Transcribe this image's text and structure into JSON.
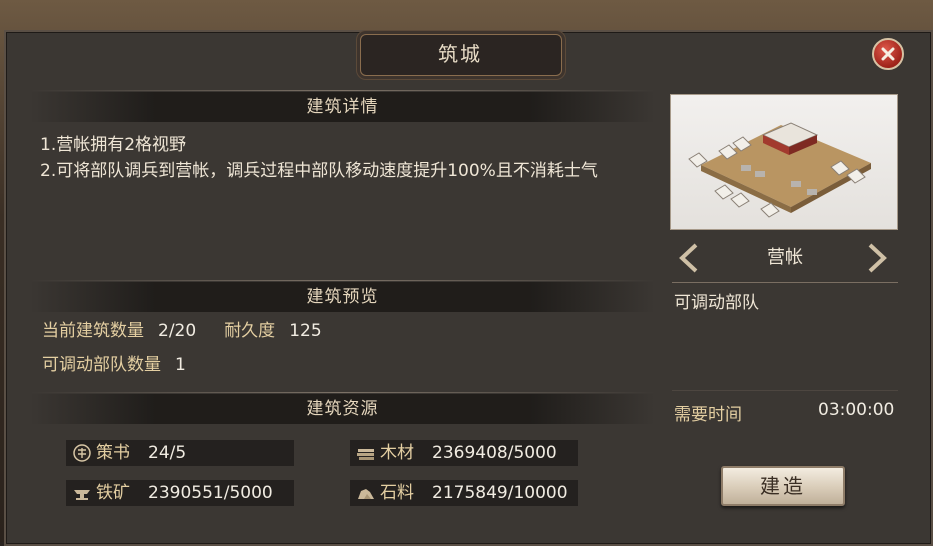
{
  "dialog": {
    "title": "筑城"
  },
  "details": {
    "header": "建筑详情",
    "lines": [
      "1.营帐拥有2格视野",
      "2.可将部队调兵到营帐，调兵过程中部队移动速度提升100%且不消耗士气"
    ]
  },
  "preview": {
    "header": "建筑预览",
    "count_label": "当前建筑数量",
    "count_value": "2/20",
    "durability_label": "耐久度",
    "durability_value": "125",
    "troops_label": "可调动部队数量",
    "troops_value": "1"
  },
  "resources": {
    "header": "建筑资源",
    "items": [
      {
        "icon": "strategy-book-icon",
        "label": "策书",
        "value": "24/5"
      },
      {
        "icon": "wood-icon",
        "label": "木材",
        "value": "2369408/5000"
      },
      {
        "icon": "iron-ore-icon",
        "label": "铁矿",
        "value": "2390551/5000"
      },
      {
        "icon": "stone-icon",
        "label": "石料",
        "value": "2175849/10000"
      }
    ]
  },
  "building": {
    "name": "营帐",
    "description": "可调动部队",
    "time_label": "需要时间",
    "time_value": "03:00:00",
    "build_label": "建造"
  }
}
